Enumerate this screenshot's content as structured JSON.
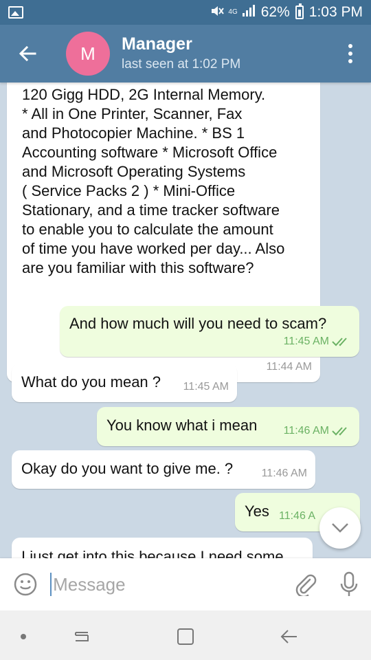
{
  "status_bar": {
    "battery": "62%",
    "time": "1:03 PM",
    "signal_label": "4G",
    "mute_icon": "mute-icon",
    "gallery_icon": "gallery-icon"
  },
  "header": {
    "avatar_letter": "M",
    "avatar_color": "#ee6f9a",
    "name": "Manager",
    "status": "last seen at 1:02 PM"
  },
  "messages": [
    {
      "direction": "in",
      "text": "120 Gigg HDD, 2G Internal Memory.\n* All in One Printer, Scanner, Fax\nand Photocopier Machine. * BS 1\nAccounting software * Microsoft Office\nand Microsoft Operating Systems\n( Service Packs 2 ) * Mini-Office\nStationary, and a time tracker software\nto enable you to calculate the amount\nof time you have worked per day... Also\nare you familiar with this software?",
      "time": "11:44 AM"
    },
    {
      "direction": "out",
      "text": "And how much will you need to scam?",
      "time": "11:45 AM",
      "read": true
    },
    {
      "direction": "in",
      "text": "What do you mean ?",
      "time": "11:45 AM"
    },
    {
      "direction": "out",
      "text": "You know what i mean",
      "time": "11:46 AM",
      "read": true
    },
    {
      "direction": "in",
      "text": "Okay do you want to give me. ?",
      "time": "11:46 AM"
    },
    {
      "direction": "out",
      "text": "Yes",
      "time": "11:46 A",
      "read": true
    },
    {
      "direction": "in",
      "text": "I just get into this because I need some",
      "time": ""
    }
  ],
  "input": {
    "placeholder": "Message"
  },
  "colors": {
    "status_bar": "#3f6e93",
    "header": "#517da2",
    "outgoing_bubble": "#effdde",
    "incoming_bubble": "#ffffff",
    "read_check": "#6bb264"
  }
}
